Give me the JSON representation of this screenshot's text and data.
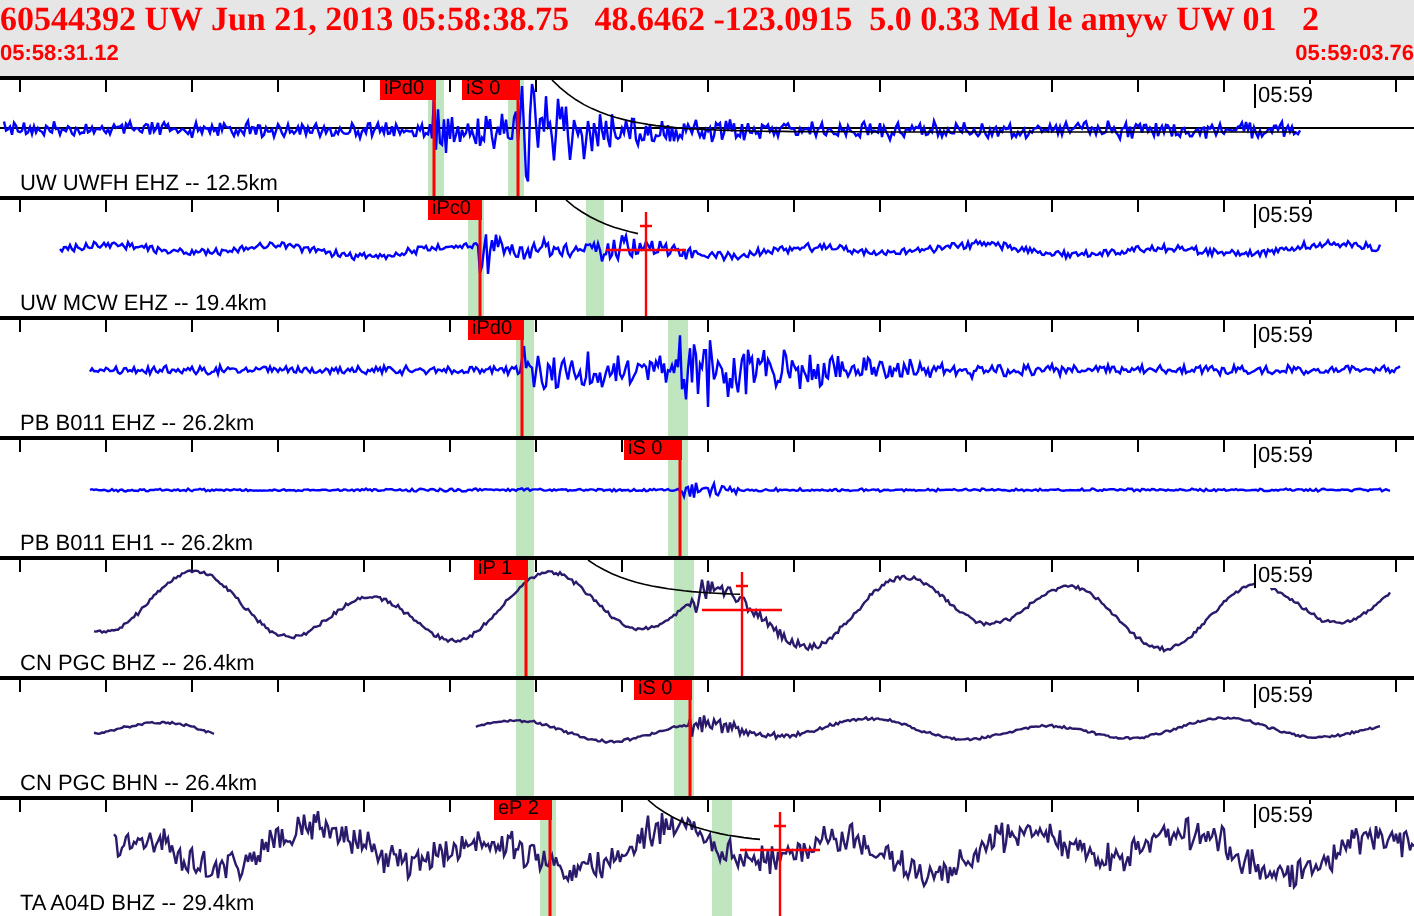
{
  "header": {
    "title": "60544392 UW Jun 21, 2013 05:58:38.75   48.6462 -123.0915  5.0 0.33 Md le amyw UW 01   2",
    "start_time": "05:58:31.12",
    "end_time": "05:59:03.76"
  },
  "channels": [
    {
      "label": "UW UWFH EHZ -- 12.5km",
      "time_mark": "05:59",
      "picks": [
        "iPd0",
        "iS 0"
      ]
    },
    {
      "label": "UW MCW EHZ -- 19.4km",
      "time_mark": "05:59",
      "picks": [
        "iPc0"
      ]
    },
    {
      "label": "PB B011 EHZ -- 26.2km",
      "time_mark": "05:59",
      "picks": [
        "iPd0"
      ]
    },
    {
      "label": "PB B011 EH1 -- 26.2km",
      "time_mark": "05:59",
      "picks": [
        "iS 0"
      ]
    },
    {
      "label": "CN PGC BHZ -- 26.4km",
      "time_mark": "05:59",
      "picks": [
        "iP 1"
      ]
    },
    {
      "label": "CN PGC BHN -- 26.4km",
      "time_mark": "05:59",
      "picks": [
        "iS 0"
      ]
    },
    {
      "label": "TA A04D BHZ -- 29.4km",
      "time_mark": "05:59",
      "picks": [
        "eP 2"
      ]
    }
  ]
}
